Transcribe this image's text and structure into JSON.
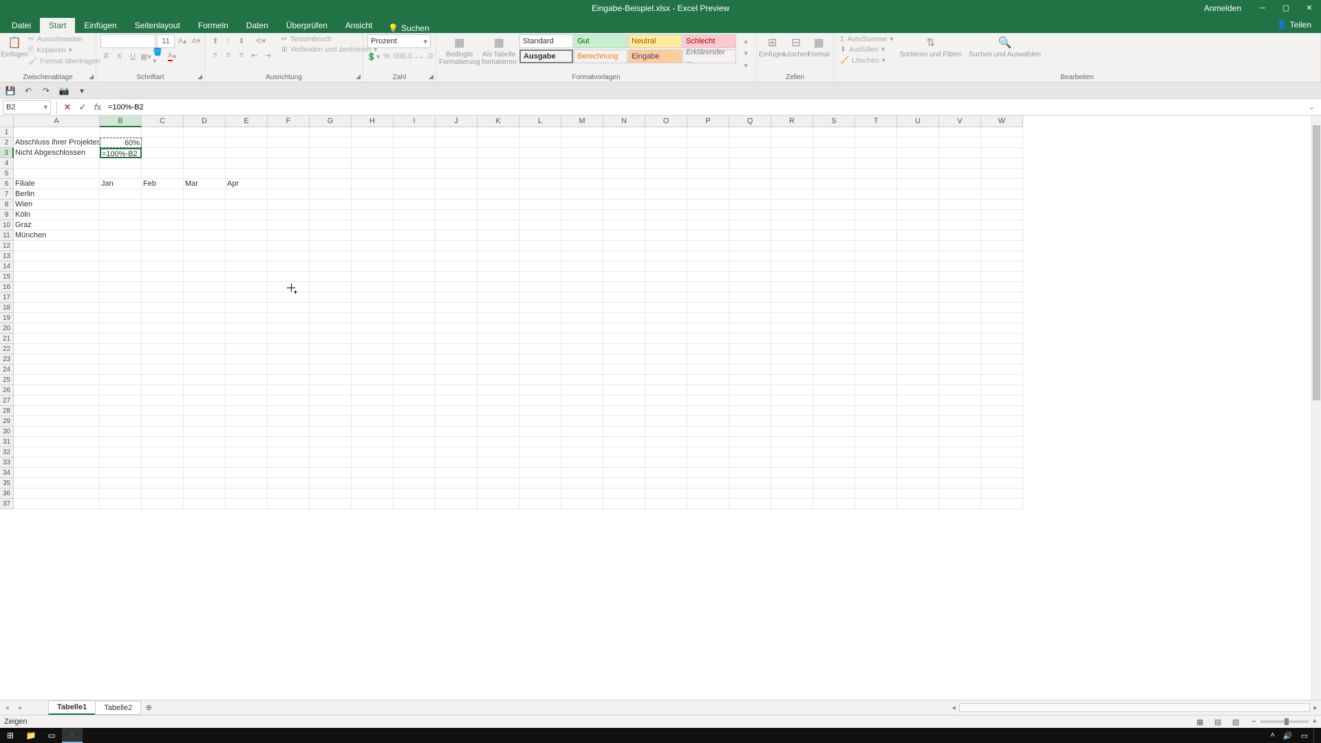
{
  "title": "Eingabe-Beispiel.xlsx - Excel Preview",
  "signin": "Anmelden",
  "menu": {
    "tabs": [
      "Datei",
      "Start",
      "Einfügen",
      "Seitenlayout",
      "Formeln",
      "Daten",
      "Überprüfen",
      "Ansicht"
    ],
    "active": "Start",
    "search": "Suchen",
    "share": "Teilen"
  },
  "ribbon": {
    "clipboard": {
      "label": "Zwischenablage",
      "paste": "Einfügen",
      "cut": "Ausschneiden",
      "copy": "Kopieren",
      "format_painter": "Format übertragen"
    },
    "font": {
      "label": "Schriftart",
      "family": "",
      "size": "11",
      "bold": "F",
      "italic": "K",
      "underline": "U"
    },
    "alignment": {
      "label": "Ausrichtung",
      "wrap": "Textumbruch",
      "merge": "Verbinden und zentrieren"
    },
    "number": {
      "label": "Zahl",
      "format": "Prozent"
    },
    "styles": {
      "label": "Formatvorlagen",
      "conditional": "Bedingte Formatierung",
      "as_table": "Als Tabelle formatieren",
      "standard": "Standard",
      "gut": "Gut",
      "neutral": "Neutral",
      "schlecht": "Schlecht",
      "ausgabe": "Ausgabe",
      "berechnung": "Berechnung",
      "eingabe": "Eingabe",
      "erklarender": "Erklärender ..."
    },
    "cells": {
      "label": "Zellen",
      "insert": "Einfügen",
      "delete": "Löschen",
      "format": "Format"
    },
    "editing": {
      "label": "Bearbeiten",
      "autosum": "AutoSumme",
      "fill": "Ausfüllen",
      "clear": "Löschen",
      "sort": "Sortieren und Filtern",
      "find": "Suchen und Auswählen"
    }
  },
  "namebox": "B2",
  "formula": "=100%-B2",
  "columns": [
    "A",
    "B",
    "C",
    "D",
    "E",
    "F",
    "G",
    "H",
    "I",
    "J",
    "K",
    "L",
    "M",
    "N",
    "O",
    "P",
    "Q",
    "R",
    "S",
    "T",
    "U",
    "V",
    "W"
  ],
  "col_widths": {
    "A": 125,
    "default": 61
  },
  "active_col": 1,
  "active_row": 2,
  "rows": 37,
  "cells": {
    "2": {
      "A": "Abschluss ihrer Projektes",
      "B": "60%"
    },
    "3": {
      "A": "Nicht Abgeschlossen",
      "B": "=100%-B2"
    },
    "6": {
      "A": "Filiale",
      "B": "Jan",
      "C": "Feb",
      "D": "Mar",
      "E": "Apr"
    },
    "7": {
      "A": "Berlin"
    },
    "8": {
      "A": "Wien"
    },
    "9": {
      "A": "Köln"
    },
    "10": {
      "A": "Graz"
    },
    "11": {
      "A": "München"
    }
  },
  "sheets": {
    "tabs": [
      "Tabelle1",
      "Tabelle2"
    ],
    "active": "Tabelle1"
  },
  "status": "Zeigen"
}
